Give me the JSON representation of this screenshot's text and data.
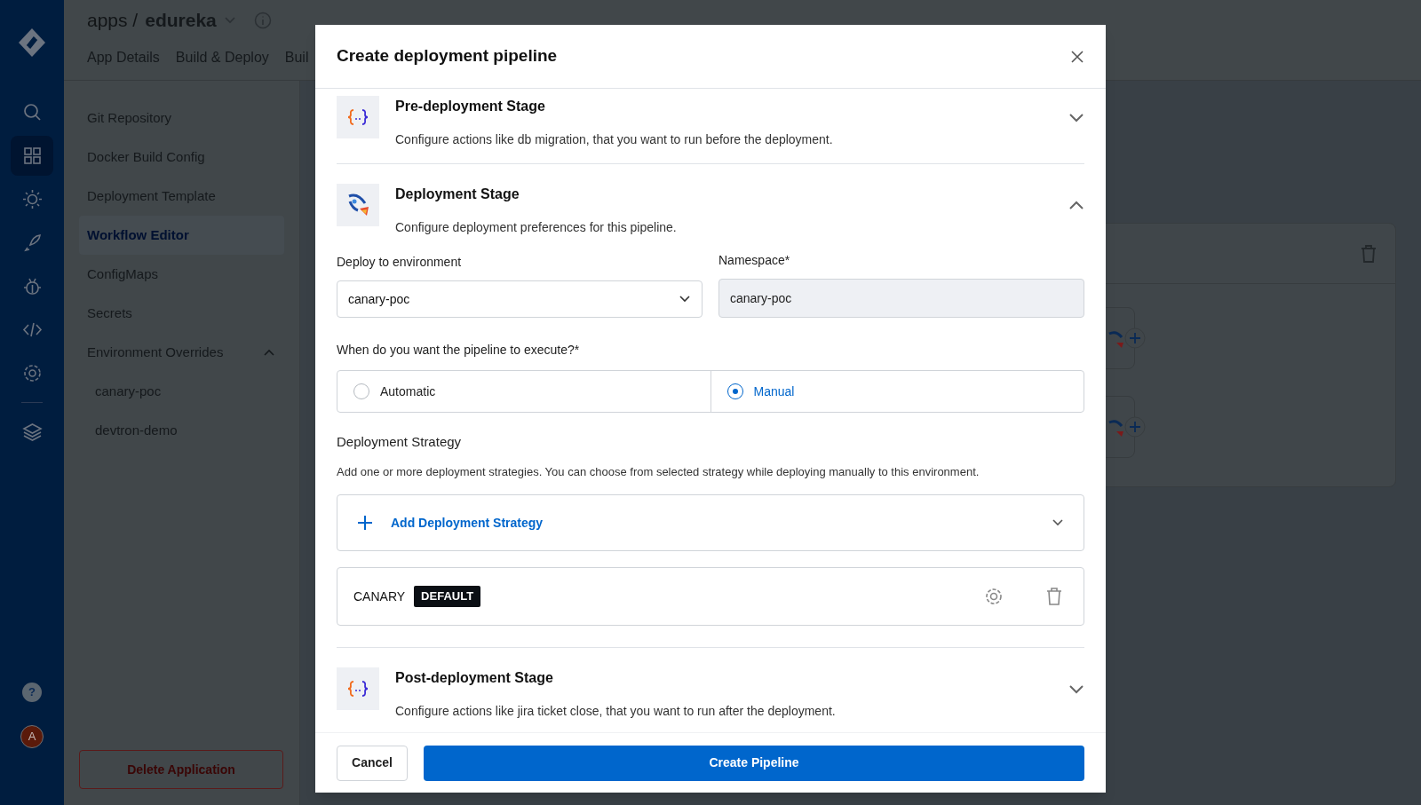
{
  "app_header": {
    "breadcrumb": "apps /",
    "app_name": "edureka",
    "tabs": [
      {
        "label": "App Details",
        "selected": false
      },
      {
        "label": "Build & Deploy",
        "selected": false
      },
      {
        "label": "Buil",
        "selected": false
      }
    ]
  },
  "config_menu": {
    "items": [
      {
        "label": "Git Repository",
        "selected": false
      },
      {
        "label": "Docker Build Config",
        "selected": false
      },
      {
        "label": "Deployment Template",
        "selected": false
      },
      {
        "label": "Workflow Editor",
        "selected": true
      },
      {
        "label": "ConfigMaps",
        "selected": false
      },
      {
        "label": "Secrets",
        "selected": false
      },
      {
        "label": "Environment Overrides",
        "selected": false,
        "expanded": true,
        "children": [
          {
            "label": "canary-poc",
            "selected": false
          },
          {
            "label": "devtron-demo",
            "selected": false
          }
        ]
      }
    ],
    "delete_button": "Delete Application"
  },
  "user_avatar": "A",
  "help_icon": "?",
  "modal": {
    "title": "Create deployment pipeline",
    "stages": [
      {
        "kind": "script",
        "title": "Pre-deployment Stage",
        "description": "Configure actions like db migration, that you want to run before the deployment.",
        "expanded": false
      },
      {
        "kind": "deploy",
        "title": "Deployment Stage",
        "description": "Configure deployment preferences for this pipeline.",
        "expanded": true
      },
      {
        "kind": "script",
        "title": "Post-deployment Stage",
        "description": "Configure actions like jira ticket close, that you want to run after the deployment.",
        "expanded": false
      }
    ],
    "environment": {
      "label": "Deploy to environment",
      "value": "canary-poc"
    },
    "namespace": {
      "label": "Namespace*",
      "value": "canary-poc"
    },
    "trigger": {
      "label": "When do you want the pipeline to execute?*",
      "options": [
        {
          "label": "Automatic",
          "selected": false
        },
        {
          "label": "Manual",
          "selected": true
        }
      ]
    },
    "strategy": {
      "title": "Deployment Strategy",
      "description": "Add one or more deployment strategies. You can choose from selected strategy while deploying manually to this environment.",
      "add_label": "Add Deployment Strategy",
      "items": [
        {
          "name": "CANARY",
          "badge": "DEFAULT"
        }
      ]
    },
    "buttons": {
      "cancel": "Cancel",
      "create": "Create Pipeline"
    }
  }
}
